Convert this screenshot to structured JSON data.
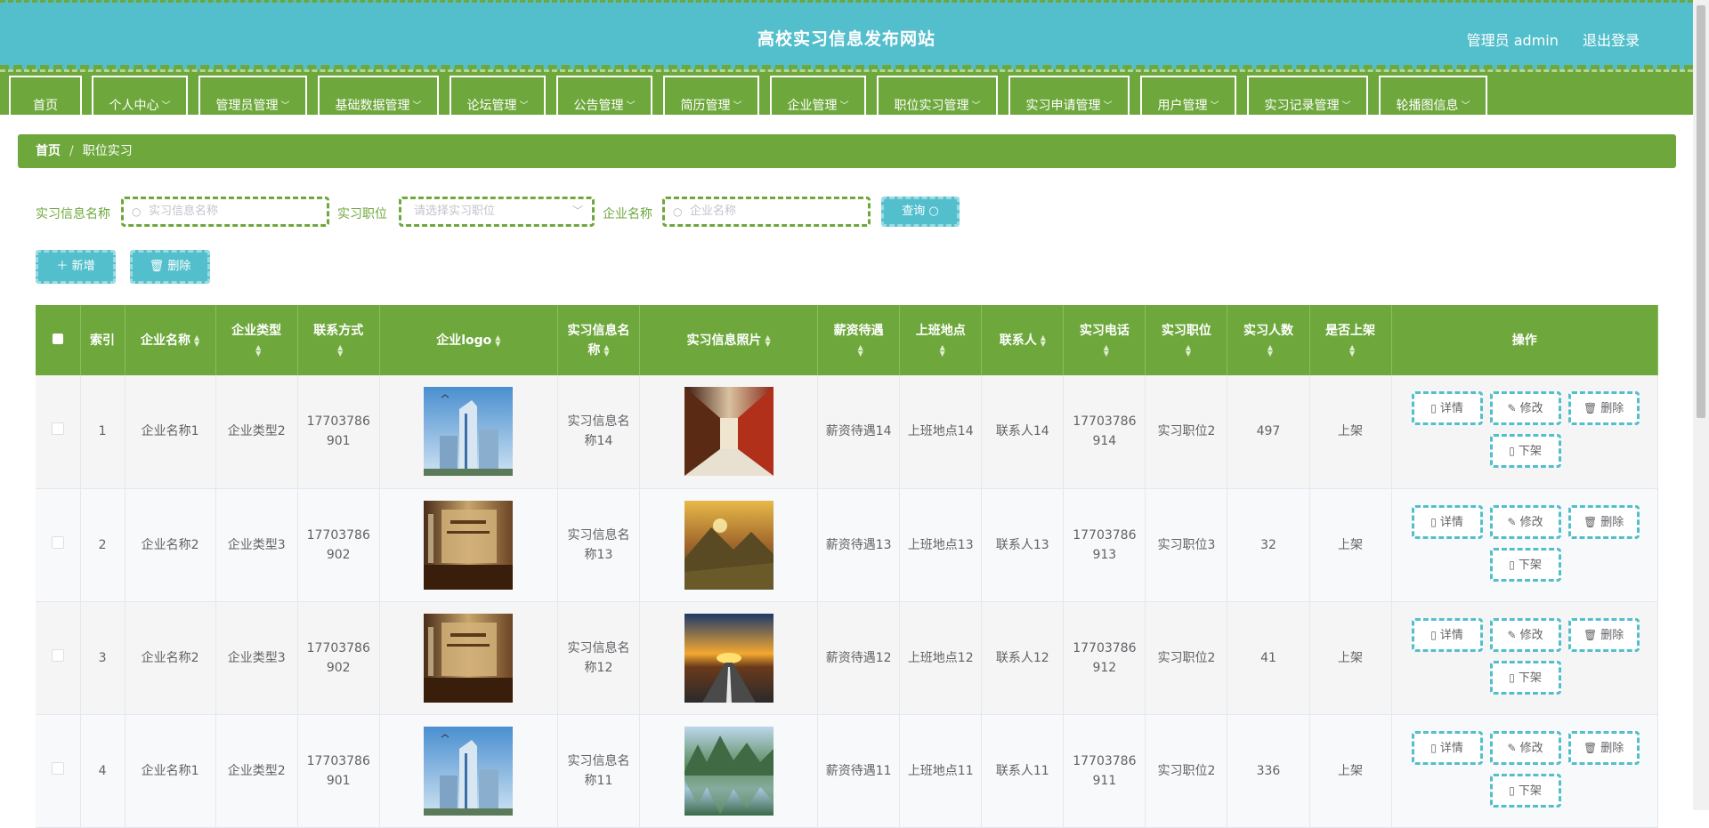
{
  "header": {
    "title": "高校实习信息发布网站",
    "user": "管理员 admin",
    "logout": "退出登录"
  },
  "nav": [
    {
      "label": "首页",
      "dropdown": false
    },
    {
      "label": "个人中心",
      "dropdown": true
    },
    {
      "label": "管理员管理",
      "dropdown": true
    },
    {
      "label": "基础数据管理",
      "dropdown": true
    },
    {
      "label": "论坛管理",
      "dropdown": true
    },
    {
      "label": "公告管理",
      "dropdown": true
    },
    {
      "label": "简历管理",
      "dropdown": true
    },
    {
      "label": "企业管理",
      "dropdown": true
    },
    {
      "label": "职位实习管理",
      "dropdown": true
    },
    {
      "label": "实习申请管理",
      "dropdown": true
    },
    {
      "label": "用户管理",
      "dropdown": true
    },
    {
      "label": "实习记录管理",
      "dropdown": true
    },
    {
      "label": "轮播图信息",
      "dropdown": true
    }
  ],
  "breadcrumb": {
    "home": "首页",
    "current": "职位实习"
  },
  "filters": {
    "name_label": "实习信息名称",
    "name_placeholder": "实习信息名称",
    "position_label": "实习职位",
    "position_placeholder": "请选择实习职位",
    "company_label": "企业名称",
    "company_placeholder": "企业名称",
    "query": "查询"
  },
  "actions": {
    "add": "新增",
    "delete": "删除"
  },
  "table": {
    "headers": [
      "索引",
      "企业名称",
      "企业类型",
      "联系方式",
      "企业logo",
      "实习信息名称",
      "实习信息照片",
      "薪资待遇",
      "上班地点",
      "联系人",
      "实习电话",
      "实习职位",
      "实习人数",
      "是否上架",
      "操作"
    ],
    "row_buttons": {
      "detail": "详情",
      "edit": "修改",
      "delete": "删除",
      "offline": "下架"
    },
    "rows": [
      {
        "index": "1",
        "company": "企业名称1",
        "type": "企业类型2",
        "contact": "17703786901",
        "logo": "building",
        "info_name": "实习信息名称14",
        "photo": "corridor",
        "salary": "薪资待遇14",
        "location": "上班地点14",
        "person": "联系人14",
        "phone": "17703786914",
        "position": "实习职位2",
        "count": "497",
        "status": "上架"
      },
      {
        "index": "2",
        "company": "企业名称2",
        "type": "企业类型3",
        "contact": "17703786902",
        "logo": "lobby",
        "info_name": "实习信息名称13",
        "photo": "mountain-sunset",
        "salary": "薪资待遇13",
        "location": "上班地点13",
        "person": "联系人13",
        "phone": "17703786913",
        "position": "实习职位3",
        "count": "32",
        "status": "上架"
      },
      {
        "index": "3",
        "company": "企业名称2",
        "type": "企业类型3",
        "contact": "17703786902",
        "logo": "lobby",
        "info_name": "实习信息名称12",
        "photo": "road-sunset",
        "salary": "薪资待遇12",
        "location": "上班地点12",
        "person": "联系人12",
        "phone": "17703786912",
        "position": "实习职位2",
        "count": "41",
        "status": "上架"
      },
      {
        "index": "4",
        "company": "企业名称1",
        "type": "企业类型2",
        "contact": "17703786901",
        "logo": "building",
        "info_name": "实习信息名称11",
        "photo": "lake-mountains",
        "salary": "薪资待遇11",
        "location": "上班地点11",
        "person": "联系人11",
        "phone": "17703786911",
        "position": "实习职位2",
        "count": "336",
        "status": "上架"
      }
    ]
  },
  "colors": {
    "header": "#54bfcc",
    "nav": "#6ea83c",
    "accent": "#54bfcc"
  }
}
